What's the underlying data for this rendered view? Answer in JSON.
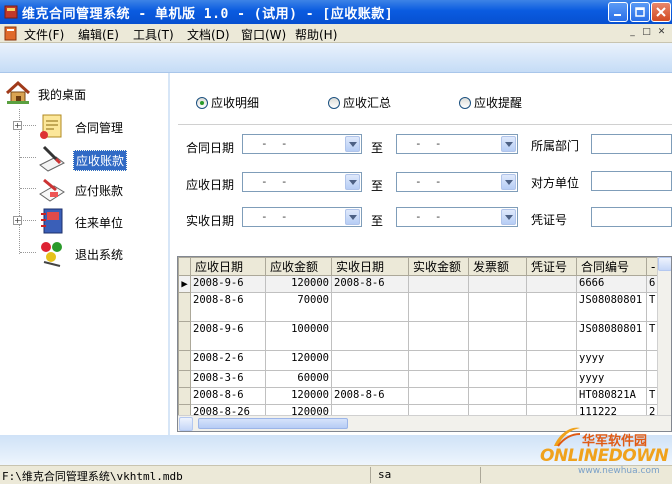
{
  "window": {
    "title": "维克合同管理系统 - 单机版 1.0 - (试用) - [应收账款]"
  },
  "menu": {
    "items": [
      "文件(F)",
      "编辑(E)",
      "工具(T)",
      "文档(D)",
      "窗口(W)",
      "帮助(H)"
    ]
  },
  "sidebar": {
    "root": "我的桌面",
    "items": [
      {
        "label": "合同管理",
        "expandable": true
      },
      {
        "label": "应收账款",
        "selected": true
      },
      {
        "label": "应付账款"
      },
      {
        "label": "往来单位",
        "expandable": true
      },
      {
        "label": "退出系统"
      }
    ]
  },
  "view_options": {
    "detail": "应收明细",
    "summary": "应收汇总",
    "reminder": "应收提醒",
    "selected": "应收明细"
  },
  "filters": {
    "contract_date": "合同日期",
    "receivable_date": "应收日期",
    "received_date": "实收日期",
    "to": "至",
    "department": "所属部门",
    "counterparty": "对方单位",
    "voucher_no": "凭证号",
    "empty_date": "-  -"
  },
  "table": {
    "columns": [
      "应收日期",
      "应收金额",
      "实收日期",
      "实收金额",
      "发票额",
      "凭证号",
      "合同编号"
    ],
    "rows": [
      [
        "2008-9-6",
        "120000",
        "2008-8-6",
        "",
        "",
        "",
        "6666",
        "6"
      ],
      [
        "2008-8-6",
        "70000",
        "",
        "",
        "",
        "",
        "JS08080801",
        "T"
      ],
      [
        "2008-9-6",
        "100000",
        "",
        "",
        "",
        "",
        "JS08080801",
        "T"
      ],
      [
        "2008-2-6",
        "120000",
        "",
        "",
        "",
        "",
        "yyyy",
        ""
      ],
      [
        "2008-3-6",
        "60000",
        "",
        "",
        "",
        "",
        "yyyy",
        ""
      ],
      [
        "2008-8-6",
        "120000",
        "2008-8-6",
        "",
        "",
        "",
        "HT080821A",
        "T"
      ],
      [
        "2008-8-26",
        "120000",
        "",
        "",
        "",
        "",
        "111222",
        "2"
      ]
    ],
    "current_row": 0
  },
  "status": {
    "db_path": "F:\\维克合同管理系统\\vkhtml.mdb",
    "user": "sa"
  },
  "watermark": {
    "cn": "华军软件园",
    "en": "ONLINEDOWN",
    "url": "www.newhua.com"
  }
}
